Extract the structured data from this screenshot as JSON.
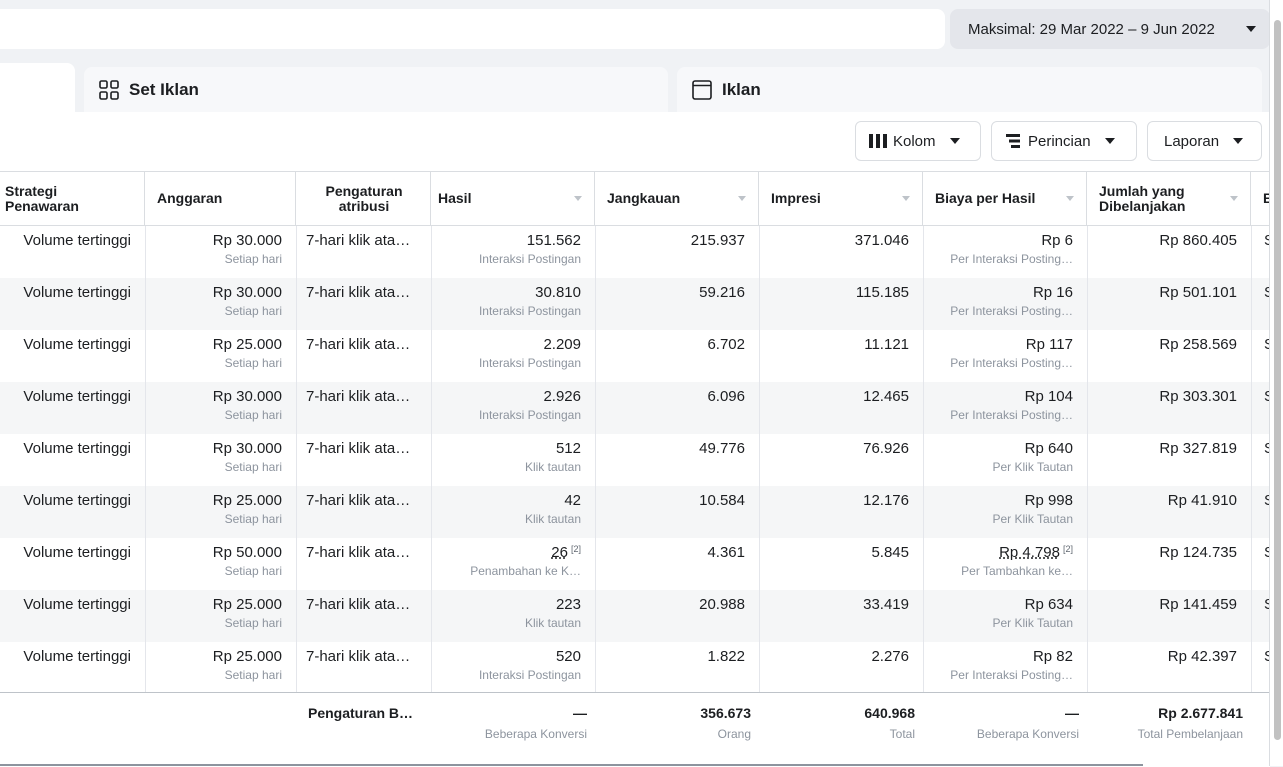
{
  "date_range": "Maksimal: 29 Mar 2022 – 9 Jun 2022",
  "tabs": {
    "adsets": "Set Iklan",
    "ads": "Iklan"
  },
  "toolbar": {
    "columns": "Kolom",
    "breakdown": "Perincian",
    "reports": "Laporan"
  },
  "headers": {
    "strategy": "Strategi Penawaran",
    "budget": "Anggaran",
    "attribution": "Pengaturan atribusi",
    "results": "Hasil",
    "reach": "Jangkauan",
    "impressions": "Impresi",
    "cost_per_result": "Biaya per Hasil",
    "amount_spent": "Jumlah yang Dibelanjakan",
    "next_col": "B"
  },
  "rows": [
    {
      "strategy": "Volume tertinggi",
      "budget": "Rp 30.000",
      "budget_sub": "Setiap hari",
      "attribution": "7-hari klik ata…",
      "results": "151.562",
      "results_sub": "Interaksi Postingan",
      "reach": "215.937",
      "impressions": "371.046",
      "cpr": "Rp 6",
      "cpr_sub": "Per Interaksi Posting…",
      "spent": "Rp 860.405",
      "next": "S"
    },
    {
      "strategy": "Volume tertinggi",
      "budget": "Rp 30.000",
      "budget_sub": "Setiap hari",
      "attribution": "7-hari klik ata…",
      "results": "30.810",
      "results_sub": "Interaksi Postingan",
      "reach": "59.216",
      "impressions": "115.185",
      "cpr": "Rp 16",
      "cpr_sub": "Per Interaksi Posting…",
      "spent": "Rp 501.101",
      "next": "S"
    },
    {
      "strategy": "Volume tertinggi",
      "budget": "Rp 25.000",
      "budget_sub": "Setiap hari",
      "attribution": "7-hari klik ata…",
      "results": "2.209",
      "results_sub": "Interaksi Postingan",
      "reach": "6.702",
      "impressions": "11.121",
      "cpr": "Rp 117",
      "cpr_sub": "Per Interaksi Posting…",
      "spent": "Rp 258.569",
      "next": "S"
    },
    {
      "strategy": "Volume tertinggi",
      "budget": "Rp 30.000",
      "budget_sub": "Setiap hari",
      "attribution": "7-hari klik ata…",
      "results": "2.926",
      "results_sub": "Interaksi Postingan",
      "reach": "6.096",
      "impressions": "12.465",
      "cpr": "Rp 104",
      "cpr_sub": "Per Interaksi Posting…",
      "spent": "Rp 303.301",
      "next": "S"
    },
    {
      "strategy": "Volume tertinggi",
      "budget": "Rp 30.000",
      "budget_sub": "Setiap hari",
      "attribution": "7-hari klik ata…",
      "results": "512",
      "results_sub": "Klik tautan",
      "reach": "49.776",
      "impressions": "76.926",
      "cpr": "Rp 640",
      "cpr_sub": "Per Klik Tautan",
      "spent": "Rp 327.819",
      "next": "S"
    },
    {
      "strategy": "Volume tertinggi",
      "budget": "Rp 25.000",
      "budget_sub": "Setiap hari",
      "attribution": "7-hari klik ata…",
      "results": "42",
      "results_sub": "Klik tautan",
      "reach": "10.584",
      "impressions": "12.176",
      "cpr": "Rp 998",
      "cpr_sub": "Per Klik Tautan",
      "spent": "Rp 41.910",
      "next": "S"
    },
    {
      "strategy": "Volume tertinggi",
      "budget": "Rp 50.000",
      "budget_sub": "Setiap hari",
      "attribution": "7-hari klik ata…",
      "results": "26",
      "results_note": "[2]",
      "results_sub": "Penambahan ke K…",
      "reach": "4.361",
      "impressions": "5.845",
      "cpr": "Rp 4.798",
      "cpr_note": "[2]",
      "cpr_sub": "Per Tambahkan ke…",
      "spent": "Rp 124.735",
      "next": "S"
    },
    {
      "strategy": "Volume tertinggi",
      "budget": "Rp 25.000",
      "budget_sub": "Setiap hari",
      "attribution": "7-hari klik ata…",
      "results": "223",
      "results_sub": "Klik tautan",
      "reach": "20.988",
      "impressions": "33.419",
      "cpr": "Rp 634",
      "cpr_sub": "Per Klik Tautan",
      "spent": "Rp 141.459",
      "next": "S"
    },
    {
      "strategy": "Volume tertinggi",
      "budget": "Rp 25.000",
      "budget_sub": "Setiap hari",
      "attribution": "7-hari klik ata…",
      "results": "520",
      "results_sub": "Interaksi Postingan",
      "reach": "1.822",
      "impressions": "2.276",
      "cpr": "Rp 82",
      "cpr_sub": "Per Interaksi Posting…",
      "spent": "Rp 42.397",
      "next": "S"
    }
  ],
  "totals": {
    "attribution": "Pengaturan B…",
    "results": "—",
    "results_sub": "Beberapa Konversi",
    "reach": "356.673",
    "reach_sub": "Orang",
    "impressions": "640.968",
    "impressions_sub": "Total",
    "cpr": "—",
    "cpr_sub": "Beberapa Konversi",
    "spent": "Rp 2.677.841",
    "spent_sub": "Total Pembelanjaan"
  }
}
